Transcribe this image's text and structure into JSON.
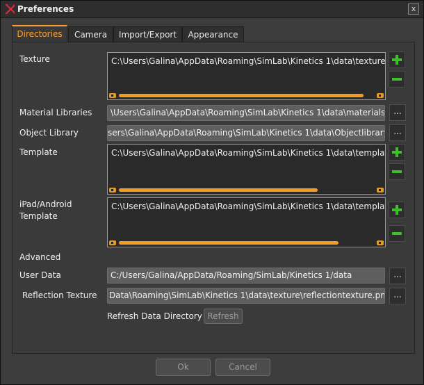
{
  "window": {
    "title": "Preferences",
    "close_label": "x"
  },
  "tabs": [
    {
      "label": "Directories",
      "active": true
    },
    {
      "label": "Camera"
    },
    {
      "label": "Import/Export"
    },
    {
      "label": "Appearance"
    }
  ],
  "directories": {
    "texture": {
      "label": "Texture",
      "path": "C:\\Users\\Galina\\AppData\\Roaming\\SimLab\\Kinetics 1\\data\\texture\\",
      "scroll_fraction": 0.96
    },
    "material_libraries": {
      "label": "Material Libraries",
      "value": "\\Users\\Galina\\AppData\\Roaming\\SimLab\\Kinetics 1\\data\\materials\\"
    },
    "object_library": {
      "label": "Object Library",
      "value": "sers\\Galina\\AppData\\Roaming\\SimLab\\Kinetics 1\\data\\Objectlibrary"
    },
    "template": {
      "label": "Template",
      "path": "C:\\Users\\Galina\\AppData\\Roaming\\SimLab\\Kinetics 1\\data\\template",
      "scroll_fraction": 0.78
    },
    "ipad_template": {
      "label_line1": "iPad/Android",
      "label_line2": "Template",
      "path": "C:\\Users\\Galina\\AppData\\Roaming\\SimLab\\Kinetics 1\\data\\template",
      "scroll_fraction": 0.86
    },
    "advanced_label": "Advanced",
    "user_data": {
      "label": "User Data",
      "value": "C:/Users/Galina/AppData/Roaming/SimLab/Kinetics 1/data"
    },
    "reflection_texture": {
      "label": "Reflection Texture",
      "value": "Data\\Roaming\\SimLab\\Kinetics 1\\data\\texture\\reflectiontexture.png"
    },
    "refresh": {
      "label": "Refresh Data Directory",
      "button": "Refresh"
    },
    "browse_label": "...",
    "icons": {
      "add": "plus-icon",
      "remove": "minus-icon"
    }
  },
  "footer": {
    "ok": "Ok",
    "cancel": "Cancel"
  },
  "colors": {
    "accent": "#f59b24",
    "add_green": "#3fbf2a",
    "app_logo": "#e02a3c"
  }
}
